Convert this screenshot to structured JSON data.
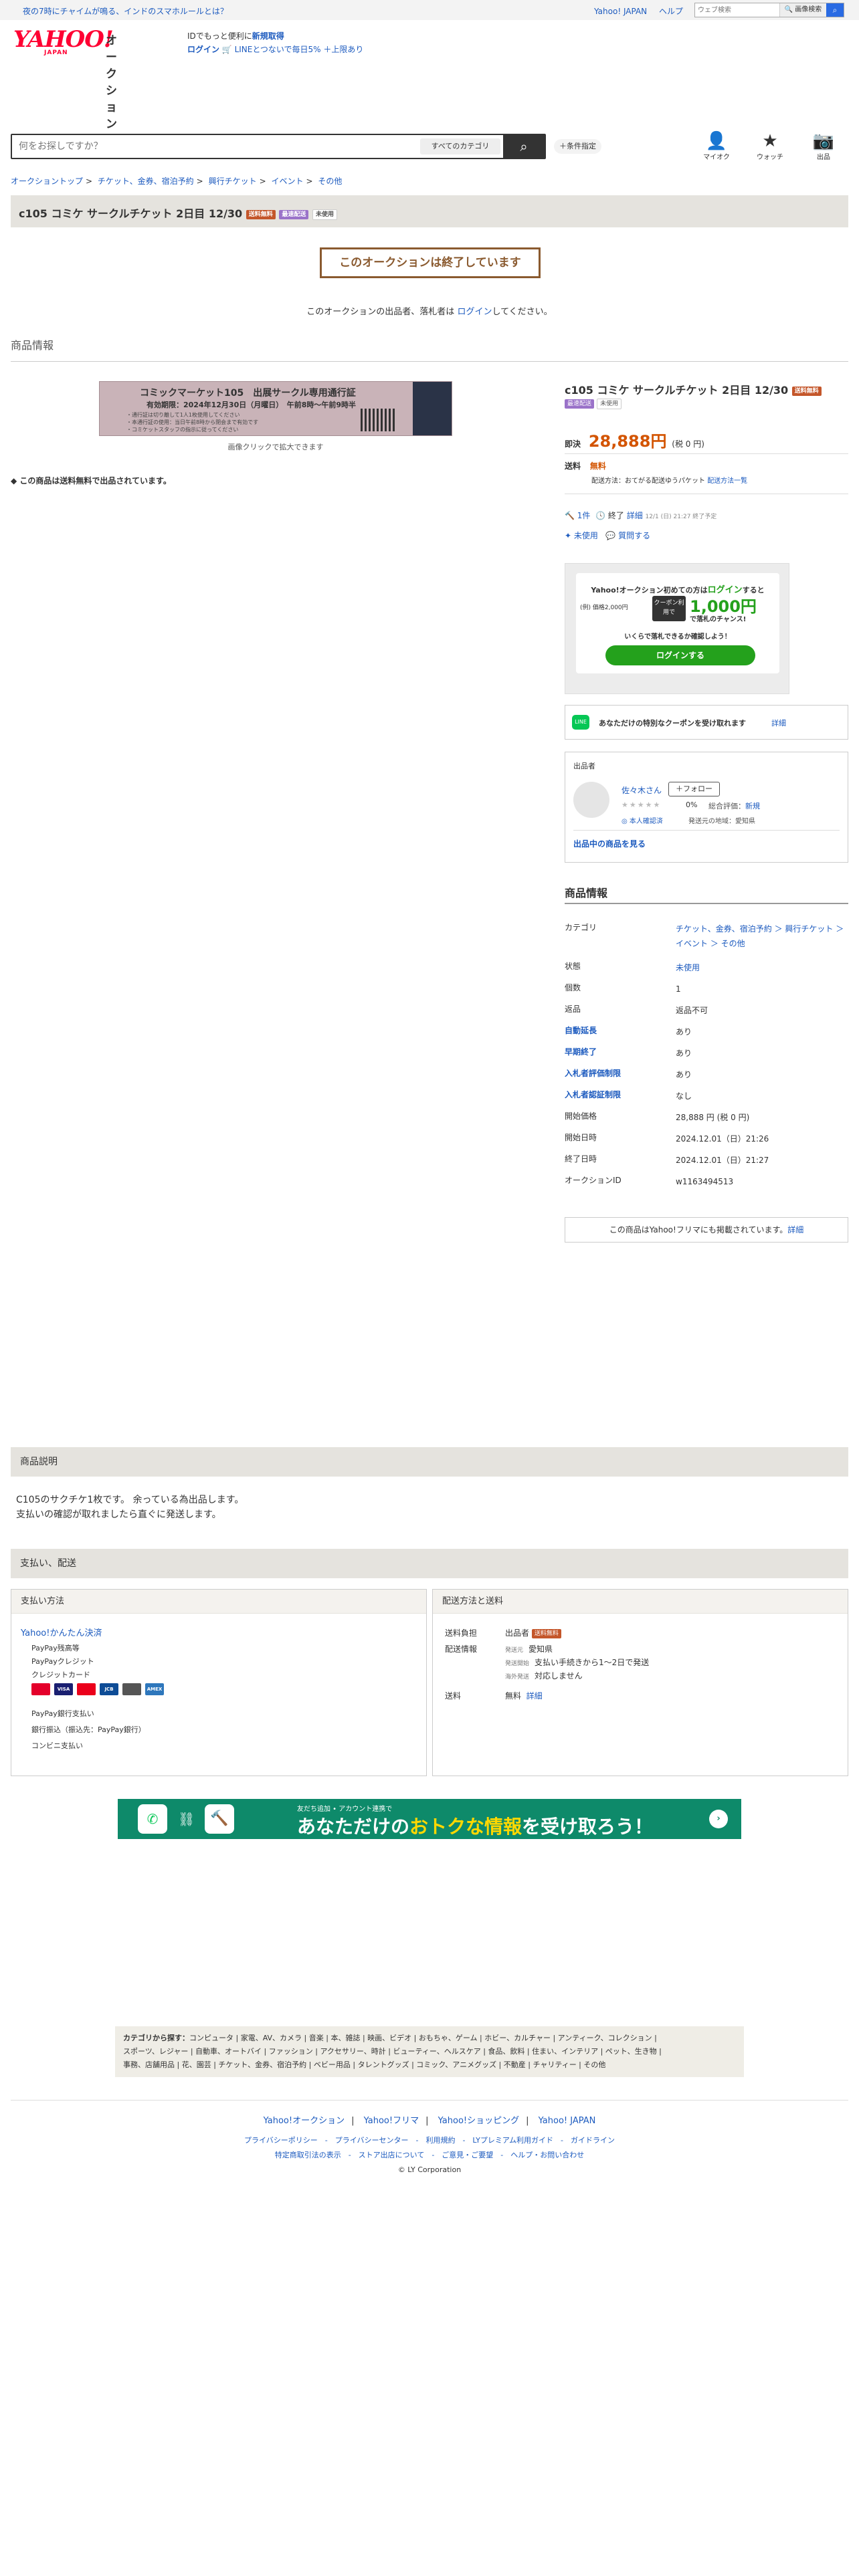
{
  "topbar": {
    "promo": "夜の7時にチャイムが鳴る、インドのスマホルールとは？",
    "links": [
      "Yahoo! JAPAN",
      "ヘルプ"
    ],
    "web_search_placeholder": "ウェブ検索",
    "web_search_button": "🔍 画像検索"
  },
  "header": {
    "logo_text": "YAHOO!",
    "logo_sub": "JAPAN",
    "logo_service": "オークション",
    "msg1_prefix": "IDでもっと便利に",
    "msg1_link": "新規取得",
    "msg2_login": "ログイン",
    "msg2_text": " 🛒 LINEとつないで毎日5% ＋上限あり"
  },
  "search": {
    "placeholder": "何をお探しですか？",
    "category": "すべてのカテゴリ",
    "conditions": "＋条件指定"
  },
  "header_icons": [
    {
      "icon": "user-icon",
      "glyph": "👤",
      "label": "マイオク"
    },
    {
      "icon": "star-icon",
      "glyph": "★",
      "label": "ウォッチ"
    },
    {
      "icon": "camera-icon",
      "glyph": "📷",
      "label": "出品"
    }
  ],
  "breadcrumb": [
    "オークショントップ",
    "チケット、金券、宿泊予約",
    "興行チケット",
    "イベント",
    "その他"
  ],
  "item": {
    "title": "c105 コミケ サークルチケット 2日目 12/30",
    "badge_free": "送料無料",
    "badge_fast": "最速配送",
    "badge_unused": "未使用"
  },
  "ended": {
    "message": "このオークションは終了しています",
    "note_prefix": "このオークションの出品者、落札者は ",
    "note_link": "ログイン",
    "note_suffix": "してください。"
  },
  "section_info": "商品情報",
  "ticket_image": {
    "title": "コミックマーケット105　出展サークル専用通行証",
    "date": "有効期限：2024年12月30日（月曜日）　午前8時〜午前9時半",
    "lines": [
      "・通行証は切り離して1人1枚使用してください",
      "・本通行証の使用：当日午前8時から閉会まで有効です",
      "・コミケットスタッフの指示に従ってください"
    ],
    "note": "画像クリックで拡大できます"
  },
  "shipping_free_note": "この商品は送料無料で出品されています。",
  "price": {
    "label": "即決",
    "value": "28,888円",
    "tax": "(税 0 円)"
  },
  "shipping": {
    "label": "送料",
    "value": "無料",
    "method": "配送方法：おてがる配送ゆうパケット",
    "method_link": "配送方法一覧"
  },
  "meta": {
    "bids": "1件",
    "status": "終了",
    "detail": "詳細",
    "end_time": "12/1 (日) 21:27 終了予定",
    "condition": "未使用",
    "question": "質問する"
  },
  "login_box": {
    "line1_prefix": "Yahoo!オークション初めての方は",
    "line1_link": "ログイン",
    "line1_suffix": "すると",
    "line2": "(例) 価格2,000円",
    "coupon": "クーポン利用で",
    "amount": "1,000円",
    "amount_sub": "で落札のチャンス!",
    "line3": "いくらで落札できるか確認しよう！",
    "button": "ログインする"
  },
  "line_box": {
    "icon": "LINE",
    "text": "あなただけの特別なクーポンを受け取れます",
    "link": "詳細"
  },
  "seller": {
    "header": "出品者",
    "name": "佐々木さん",
    "follow": "＋フォロー",
    "stars": "★★★★★",
    "percent": "0%",
    "total_label": "総合評価：",
    "total_link": "新規",
    "verified": "◎ 本人確認済",
    "location": "発送元の地域：愛知県",
    "listing_link": "出品中の商品を見る"
  },
  "product_info": {
    "heading": "商品情報",
    "rows": [
      {
        "key": "カテゴリ",
        "value": "チケット、金券、宿泊予約 ＞ 興行チケット ＞ イベント ＞ その他"
      },
      {
        "key": "状態",
        "value": "未使用"
      },
      {
        "key": "個数",
        "value": "1"
      },
      {
        "key": "返品",
        "value": "返品不可"
      },
      {
        "key": "自動延長",
        "value": "あり"
      },
      {
        "key": "早期終了",
        "value": "あり"
      },
      {
        "key": "入札者評価制限",
        "value": "あり"
      },
      {
        "key": "入札者認証制限",
        "value": "なし"
      },
      {
        "key": "開始価格",
        "value": "28,888 円 (税 0 円)"
      },
      {
        "key": "開始日時",
        "value": "2024.12.01（日）21:26"
      },
      {
        "key": "終了日時",
        "value": "2024.12.01（日）21:27"
      },
      {
        "key": "オークションID",
        "value": "w1163494513"
      }
    ],
    "furima_prefix": "この商品はYahoo!フリマにも掲載されています。",
    "furima_link": "詳細"
  },
  "description": {
    "heading": "商品説明",
    "line1": "C105のサクチケ1枚です。 余っている為出品します。",
    "line2": "支払いの確認が取れましたら直ぐに発送します。"
  },
  "payment_shipping": {
    "heading": "支払い、配送",
    "payment_heading": "支払い方法",
    "kantan": "Yahoo!かんたん決済",
    "methods1": [
      "PayPay残高等",
      "PayPayクレジット",
      "クレジットカード"
    ],
    "methods2": [
      "PayPay銀行支払い",
      "銀行振込（振込先：PayPay銀行）",
      "コンビニ支払い"
    ],
    "shipping_heading": "配送方法と送料",
    "burden_label": "送料負担",
    "burden_value": "出品者",
    "info_label": "配送情報",
    "origin_label": "発送元",
    "origin_value": "愛知県",
    "start_label": "発送開始",
    "start_value": "支払い手続きから1〜2日で発送",
    "overseas_label": "海外発送",
    "overseas_value": "対応しません",
    "fee_label": "送料",
    "fee_value": "無料",
    "fee_link": "詳細"
  },
  "banner": {
    "small": "友だち追加 • アカウント連携で",
    "main_prefix": "あなただけの",
    "main_yellow": "おトクな情報",
    "main_suffix": "を受け取ろう！"
  },
  "categories": {
    "label": "カテゴリから探す：",
    "line1": "コンピュータ | 家電、AV、カメラ | 音楽 | 本、雑誌 | 映画、ビデオ | おもちゃ、ゲーム | ホビー、カルチャー | アンティーク、コレクション |",
    "line2": "スポーツ、レジャー | 自動車、オートバイ | ファッション | アクセサリー、時計 | ビューティー、ヘルスケア | 食品、飲料 | 住まい、インテリア | ペット、生き物 |",
    "line3": "事務、店舗用品 | 花、園芸 | チケット、金券、宿泊予約 | ベビー用品 | タレントグッズ | コミック、アニメグッズ | 不動産 | チャリティー | その他"
  },
  "footer": {
    "main_links": [
      "Yahoo!オークション",
      "Yahoo!フリマ",
      "Yahoo!ショッピング",
      "Yahoo! JAPAN"
    ],
    "links2": "プライバシーポリシー　-　プライバシーセンター　-　利用規約　-　LYプレミアム利用ガイド　-　ガイドライン",
    "links3": "特定商取引法の表示　-　ストア出店について　-　ご意見・ご要望　-　ヘルプ・お問い合わせ",
    "copyright": "© LY Corporation"
  }
}
